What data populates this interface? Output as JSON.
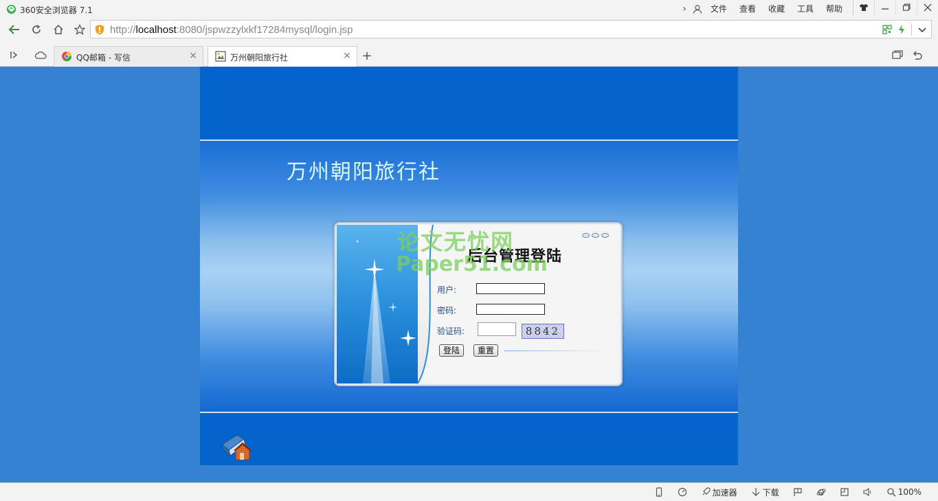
{
  "browser": {
    "title": "360安全浏览器 7.1",
    "menu": [
      "文件",
      "查看",
      "收藏",
      "工具",
      "帮助"
    ],
    "url_prefix": "http://",
    "url_host": "localhost",
    "url_rest": ":8080/jspwzzylxkf17284mysql/login.jsp",
    "tabs": [
      {
        "label": "QQ邮箱 - 写信",
        "active": false
      },
      {
        "label": "万州朝阳旅行社",
        "active": true
      }
    ]
  },
  "page": {
    "site_title": "万州朝阳旅行社",
    "login_heading": "后台管理登陆",
    "user_label": "用户:",
    "password_label": "密码:",
    "captcha_label": "验证码:",
    "captcha_code": "8842",
    "login_button": "登陆",
    "reset_button": "重置",
    "watermark_line1": "论文无忧网",
    "watermark_line2": "Paper51.com"
  },
  "statusbar": {
    "accelerator": "加速器",
    "download": "下载",
    "zoom": "100%"
  },
  "colors": {
    "page_bg": "#3582d2",
    "page_panel": "#0563ce",
    "title_text": "#d7f7ef",
    "watermark": "#7bd05b"
  }
}
